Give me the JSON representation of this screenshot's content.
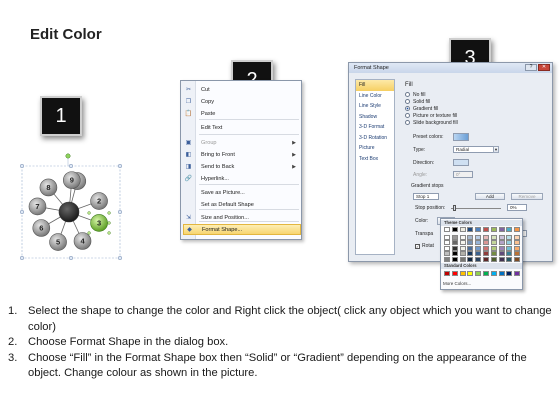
{
  "page_title": "Edit Color",
  "badges": [
    "1",
    "2",
    "3"
  ],
  "ring_numbers": [
    "1",
    "2",
    "3",
    "4",
    "5",
    "6",
    "7",
    "8",
    "9"
  ],
  "context_menu": {
    "items": [
      {
        "label": "Cut",
        "icon": "scissors-icon",
        "glyph": "✂",
        "disabled": false,
        "submenu": false
      },
      {
        "label": "Copy",
        "icon": "copy-icon",
        "glyph": "❐",
        "disabled": false,
        "submenu": false
      },
      {
        "label": "Paste",
        "icon": "paste-icon",
        "glyph": "📋",
        "disabled": false,
        "submenu": false
      },
      {
        "label": "Edit Text",
        "icon": "",
        "glyph": "",
        "disabled": false,
        "submenu": false
      },
      {
        "label": "Group",
        "icon": "group-icon",
        "glyph": "▣",
        "disabled": true,
        "submenu": true
      },
      {
        "label": "Bring to Front",
        "icon": "bring-front-icon",
        "glyph": "◧",
        "disabled": false,
        "submenu": true
      },
      {
        "label": "Send to Back",
        "icon": "send-back-icon",
        "glyph": "◨",
        "disabled": false,
        "submenu": true
      },
      {
        "label": "Hyperlink...",
        "icon": "hyperlink-icon",
        "glyph": "🔗",
        "disabled": false,
        "submenu": false
      },
      {
        "label": "Save as Picture...",
        "icon": "",
        "glyph": "",
        "disabled": false,
        "submenu": false
      },
      {
        "label": "Set as Default Shape",
        "icon": "",
        "glyph": "",
        "disabled": false,
        "submenu": false
      },
      {
        "label": "Size and Position...",
        "icon": "size-icon",
        "glyph": "⇲",
        "disabled": false,
        "submenu": false
      },
      {
        "label": "Format Shape...",
        "icon": "format-shape-icon",
        "glyph": "◆",
        "disabled": false,
        "submenu": false
      }
    ]
  },
  "dialog": {
    "title": "Format Shape",
    "nav": [
      "Fill",
      "Line Color",
      "Line Style",
      "Shadow",
      "3-D Format",
      "3-D Rotation",
      "Picture",
      "Text Box"
    ],
    "fill_heading": "Fill",
    "options": [
      "No fill",
      "Solid fill",
      "Gradient fill",
      "Picture or texture fill",
      "Slide background fill"
    ],
    "preset_label": "Preset colors:",
    "type_label": "Type:",
    "type_value": "Radial",
    "direction_label": "Direction:",
    "angle_label": "Angle:",
    "angle_value": "0°",
    "stops_label": "Gradient stops",
    "stop_value": "Stop 1",
    "add_label": "Add",
    "remove_label": "Remove",
    "stop_pos_label": "Stop position:",
    "stop_pos_value": "0%",
    "color_label": "Color:",
    "transparency_label": "Transpa",
    "transparency_value": "0%",
    "rotate_label": "Rotat"
  },
  "palette": {
    "theme_label": "Theme Colors",
    "standard_label": "Standard Colors",
    "more_label": "More Colors...",
    "theme_row": [
      "#ffffff",
      "#000000",
      "#eeece1",
      "#1f497d",
      "#4f81bd",
      "#c0504d",
      "#9bbb59",
      "#8064a2",
      "#4bacc6",
      "#f79646"
    ],
    "standard_row": [
      "#c00000",
      "#ff0000",
      "#ffc000",
      "#ffff00",
      "#92d050",
      "#00b050",
      "#00b0f0",
      "#0070c0",
      "#002060",
      "#7030a0"
    ]
  },
  "steps": [
    {
      "num": "1.",
      "text": "Select the shape to change the color and Right click the object( click any object which you want to change color)"
    },
    {
      "num": "2.",
      "text": "Choose Format Shape in the dialog box."
    },
    {
      "num": "3.",
      "text": "Choose “Fill” in the Format Shape box then “Solid” or “Gradient” depending on the appearance of the object. Change colour as shown in the picture."
    }
  ],
  "colors": {
    "selected_circle": "#7dc43b",
    "circle_gray": "#9a9a9a",
    "center_dark": "#2c2c2c"
  }
}
